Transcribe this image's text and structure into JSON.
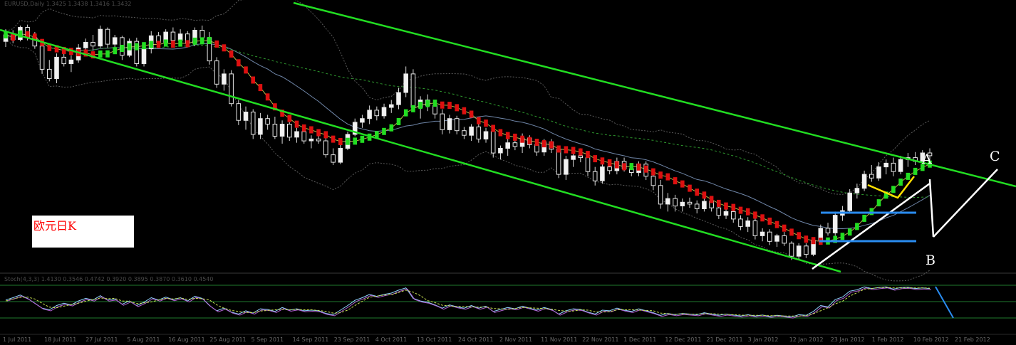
{
  "chart_data": {
    "type": "candlestick",
    "title_box": "欧元日K",
    "main_info": "EURUSD,Daily  1.3425 1.3438 1.3416 1.3432",
    "osc_info": "Stoch(4,3,3) 1.4130 0.3546 0.4742 0.3920 0.3895 0.3870 0.3610 0.4540",
    "wave_labels": [
      "A",
      "B",
      "C"
    ],
    "x_dates": [
      "1 Jul 2011",
      "18 Jul 2011",
      "27 Jul 2011",
      "5 Aug 2011",
      "16 Aug 2011",
      "25 Aug 2011",
      "5 Sep 2011",
      "14 Sep 2011",
      "23 Sep 2011",
      "4 Oct 2011",
      "13 Oct 2011",
      "24 Oct 2011",
      "2 Nov 2011",
      "11 Nov 2011",
      "22 Nov 2011",
      "1 Dec 2011",
      "12 Dec 2011",
      "21 Dec 2011",
      "3 Jan 2012",
      "12 Jan 2012",
      "23 Jan 2012",
      "1 Feb 2012",
      "10 Feb 2012",
      "21 Feb 2012"
    ],
    "candles": [
      {
        "o": 1.445,
        "h": 1.458,
        "l": 1.439,
        "c": 1.452
      },
      {
        "o": 1.452,
        "h": 1.457,
        "l": 1.443,
        "c": 1.447
      },
      {
        "o": 1.447,
        "h": 1.462,
        "l": 1.445,
        "c": 1.46
      },
      {
        "o": 1.46,
        "h": 1.463,
        "l": 1.446,
        "c": 1.449
      },
      {
        "o": 1.449,
        "h": 1.455,
        "l": 1.437,
        "c": 1.44
      },
      {
        "o": 1.44,
        "h": 1.443,
        "l": 1.41,
        "c": 1.415
      },
      {
        "o": 1.415,
        "h": 1.425,
        "l": 1.402,
        "c": 1.405
      },
      {
        "o": 1.405,
        "h": 1.432,
        "l": 1.4,
        "c": 1.428
      },
      {
        "o": 1.428,
        "h": 1.436,
        "l": 1.418,
        "c": 1.421
      },
      {
        "o": 1.421,
        "h": 1.43,
        "l": 1.412,
        "c": 1.425
      },
      {
        "o": 1.425,
        "h": 1.442,
        "l": 1.422,
        "c": 1.438
      },
      {
        "o": 1.438,
        "h": 1.448,
        "l": 1.43,
        "c": 1.444
      },
      {
        "o": 1.444,
        "h": 1.452,
        "l": 1.435,
        "c": 1.44
      },
      {
        "o": 1.44,
        "h": 1.462,
        "l": 1.438,
        "c": 1.458
      },
      {
        "o": 1.458,
        "h": 1.46,
        "l": 1.438,
        "c": 1.442
      },
      {
        "o": 1.442,
        "h": 1.452,
        "l": 1.432,
        "c": 1.449
      },
      {
        "o": 1.449,
        "h": 1.451,
        "l": 1.425,
        "c": 1.43
      },
      {
        "o": 1.43,
        "h": 1.448,
        "l": 1.428,
        "c": 1.445
      },
      {
        "o": 1.445,
        "h": 1.449,
        "l": 1.418,
        "c": 1.421
      },
      {
        "o": 1.421,
        "h": 1.44,
        "l": 1.418,
        "c": 1.437
      },
      {
        "o": 1.437,
        "h": 1.456,
        "l": 1.432,
        "c": 1.451
      },
      {
        "o": 1.451,
        "h": 1.455,
        "l": 1.44,
        "c": 1.444
      },
      {
        "o": 1.444,
        "h": 1.458,
        "l": 1.44,
        "c": 1.455
      },
      {
        "o": 1.455,
        "h": 1.46,
        "l": 1.442,
        "c": 1.446
      },
      {
        "o": 1.446,
        "h": 1.458,
        "l": 1.441,
        "c": 1.453
      },
      {
        "o": 1.453,
        "h": 1.456,
        "l": 1.44,
        "c": 1.443
      },
      {
        "o": 1.443,
        "h": 1.46,
        "l": 1.44,
        "c": 1.457
      },
      {
        "o": 1.457,
        "h": 1.462,
        "l": 1.445,
        "c": 1.449
      },
      {
        "o": 1.449,
        "h": 1.455,
        "l": 1.42,
        "c": 1.424
      },
      {
        "o": 1.424,
        "h": 1.428,
        "l": 1.395,
        "c": 1.399
      },
      {
        "o": 1.399,
        "h": 1.415,
        "l": 1.392,
        "c": 1.41
      },
      {
        "o": 1.41,
        "h": 1.414,
        "l": 1.375,
        "c": 1.378
      },
      {
        "o": 1.378,
        "h": 1.382,
        "l": 1.355,
        "c": 1.36
      },
      {
        "o": 1.36,
        "h": 1.375,
        "l": 1.35,
        "c": 1.369
      },
      {
        "o": 1.369,
        "h": 1.372,
        "l": 1.34,
        "c": 1.345
      },
      {
        "o": 1.345,
        "h": 1.368,
        "l": 1.34,
        "c": 1.362
      },
      {
        "o": 1.362,
        "h": 1.366,
        "l": 1.35,
        "c": 1.356
      },
      {
        "o": 1.356,
        "h": 1.364,
        "l": 1.34,
        "c": 1.343
      },
      {
        "o": 1.343,
        "h": 1.36,
        "l": 1.335,
        "c": 1.356
      },
      {
        "o": 1.356,
        "h": 1.358,
        "l": 1.338,
        "c": 1.342
      },
      {
        "o": 1.342,
        "h": 1.352,
        "l": 1.336,
        "c": 1.348
      },
      {
        "o": 1.348,
        "h": 1.35,
        "l": 1.335,
        "c": 1.338
      },
      {
        "o": 1.338,
        "h": 1.344,
        "l": 1.33,
        "c": 1.34
      },
      {
        "o": 1.34,
        "h": 1.345,
        "l": 1.335,
        "c": 1.338
      },
      {
        "o": 1.338,
        "h": 1.342,
        "l": 1.32,
        "c": 1.323
      },
      {
        "o": 1.323,
        "h": 1.33,
        "l": 1.312,
        "c": 1.315
      },
      {
        "o": 1.315,
        "h": 1.334,
        "l": 1.313,
        "c": 1.33
      },
      {
        "o": 1.33,
        "h": 1.348,
        "l": 1.328,
        "c": 1.345
      },
      {
        "o": 1.345,
        "h": 1.362,
        "l": 1.343,
        "c": 1.358
      },
      {
        "o": 1.358,
        "h": 1.366,
        "l": 1.352,
        "c": 1.362
      },
      {
        "o": 1.362,
        "h": 1.376,
        "l": 1.356,
        "c": 1.371
      },
      {
        "o": 1.371,
        "h": 1.375,
        "l": 1.36,
        "c": 1.365
      },
      {
        "o": 1.365,
        "h": 1.378,
        "l": 1.362,
        "c": 1.374
      },
      {
        "o": 1.374,
        "h": 1.382,
        "l": 1.368,
        "c": 1.377
      },
      {
        "o": 1.377,
        "h": 1.395,
        "l": 1.372,
        "c": 1.39
      },
      {
        "o": 1.39,
        "h": 1.418,
        "l": 1.385,
        "c": 1.41
      },
      {
        "o": 1.41,
        "h": 1.415,
        "l": 1.37,
        "c": 1.374
      },
      {
        "o": 1.374,
        "h": 1.386,
        "l": 1.362,
        "c": 1.382
      },
      {
        "o": 1.382,
        "h": 1.388,
        "l": 1.37,
        "c": 1.376
      },
      {
        "o": 1.376,
        "h": 1.38,
        "l": 1.362,
        "c": 1.367
      },
      {
        "o": 1.367,
        "h": 1.372,
        "l": 1.345,
        "c": 1.35
      },
      {
        "o": 1.35,
        "h": 1.366,
        "l": 1.346,
        "c": 1.362
      },
      {
        "o": 1.362,
        "h": 1.365,
        "l": 1.345,
        "c": 1.349
      },
      {
        "o": 1.349,
        "h": 1.353,
        "l": 1.34,
        "c": 1.344
      },
      {
        "o": 1.344,
        "h": 1.356,
        "l": 1.338,
        "c": 1.353
      },
      {
        "o": 1.353,
        "h": 1.356,
        "l": 1.336,
        "c": 1.34
      },
      {
        "o": 1.34,
        "h": 1.352,
        "l": 1.336,
        "c": 1.348
      },
      {
        "o": 1.348,
        "h": 1.35,
        "l": 1.32,
        "c": 1.325
      },
      {
        "o": 1.325,
        "h": 1.333,
        "l": 1.318,
        "c": 1.33
      },
      {
        "o": 1.33,
        "h": 1.34,
        "l": 1.322,
        "c": 1.336
      },
      {
        "o": 1.336,
        "h": 1.342,
        "l": 1.328,
        "c": 1.332
      },
      {
        "o": 1.332,
        "h": 1.346,
        "l": 1.325,
        "c": 1.341
      },
      {
        "o": 1.341,
        "h": 1.344,
        "l": 1.33,
        "c": 1.334
      },
      {
        "o": 1.334,
        "h": 1.338,
        "l": 1.322,
        "c": 1.326
      },
      {
        "o": 1.326,
        "h": 1.34,
        "l": 1.322,
        "c": 1.337
      },
      {
        "o": 1.337,
        "h": 1.34,
        "l": 1.325,
        "c": 1.329
      },
      {
        "o": 1.329,
        "h": 1.333,
        "l": 1.298,
        "c": 1.302
      },
      {
        "o": 1.302,
        "h": 1.322,
        "l": 1.296,
        "c": 1.318
      },
      {
        "o": 1.318,
        "h": 1.326,
        "l": 1.31,
        "c": 1.322
      },
      {
        "o": 1.322,
        "h": 1.33,
        "l": 1.315,
        "c": 1.32
      },
      {
        "o": 1.32,
        "h": 1.326,
        "l": 1.3,
        "c": 1.305
      },
      {
        "o": 1.305,
        "h": 1.31,
        "l": 1.29,
        "c": 1.295
      },
      {
        "o": 1.295,
        "h": 1.315,
        "l": 1.292,
        "c": 1.31
      },
      {
        "o": 1.31,
        "h": 1.316,
        "l": 1.302,
        "c": 1.306
      },
      {
        "o": 1.306,
        "h": 1.32,
        "l": 1.302,
        "c": 1.316
      },
      {
        "o": 1.316,
        "h": 1.32,
        "l": 1.305,
        "c": 1.308
      },
      {
        "o": 1.308,
        "h": 1.312,
        "l": 1.3,
        "c": 1.304
      },
      {
        "o": 1.304,
        "h": 1.316,
        "l": 1.3,
        "c": 1.313
      },
      {
        "o": 1.313,
        "h": 1.316,
        "l": 1.296,
        "c": 1.3
      },
      {
        "o": 1.3,
        "h": 1.305,
        "l": 1.285,
        "c": 1.29
      },
      {
        "o": 1.29,
        "h": 1.296,
        "l": 1.265,
        "c": 1.27
      },
      {
        "o": 1.27,
        "h": 1.282,
        "l": 1.262,
        "c": 1.276
      },
      {
        "o": 1.276,
        "h": 1.28,
        "l": 1.262,
        "c": 1.268
      },
      {
        "o": 1.268,
        "h": 1.276,
        "l": 1.262,
        "c": 1.272
      },
      {
        "o": 1.272,
        "h": 1.277,
        "l": 1.266,
        "c": 1.27
      },
      {
        "o": 1.27,
        "h": 1.274,
        "l": 1.26,
        "c": 1.265
      },
      {
        "o": 1.265,
        "h": 1.276,
        "l": 1.262,
        "c": 1.273
      },
      {
        "o": 1.273,
        "h": 1.276,
        "l": 1.262,
        "c": 1.266
      },
      {
        "o": 1.266,
        "h": 1.27,
        "l": 1.254,
        "c": 1.258
      },
      {
        "o": 1.258,
        "h": 1.266,
        "l": 1.254,
        "c": 1.262
      },
      {
        "o": 1.262,
        "h": 1.265,
        "l": 1.25,
        "c": 1.254
      },
      {
        "o": 1.254,
        "h": 1.258,
        "l": 1.242,
        "c": 1.246
      },
      {
        "o": 1.246,
        "h": 1.256,
        "l": 1.24,
        "c": 1.252
      },
      {
        "o": 1.252,
        "h": 1.255,
        "l": 1.232,
        "c": 1.236
      },
      {
        "o": 1.236,
        "h": 1.244,
        "l": 1.23,
        "c": 1.24
      },
      {
        "o": 1.24,
        "h": 1.243,
        "l": 1.226,
        "c": 1.23
      },
      {
        "o": 1.23,
        "h": 1.238,
        "l": 1.224,
        "c": 1.236
      },
      {
        "o": 1.236,
        "h": 1.24,
        "l": 1.225,
        "c": 1.228
      },
      {
        "o": 1.228,
        "h": 1.23,
        "l": 1.21,
        "c": 1.214
      },
      {
        "o": 1.214,
        "h": 1.228,
        "l": 1.21,
        "c": 1.225
      },
      {
        "o": 1.225,
        "h": 1.228,
        "l": 1.212,
        "c": 1.216
      },
      {
        "o": 1.216,
        "h": 1.234,
        "l": 1.214,
        "c": 1.231
      },
      {
        "o": 1.231,
        "h": 1.248,
        "l": 1.228,
        "c": 1.244
      },
      {
        "o": 1.244,
        "h": 1.25,
        "l": 1.236,
        "c": 1.239
      },
      {
        "o": 1.239,
        "h": 1.262,
        "l": 1.236,
        "c": 1.258
      },
      {
        "o": 1.258,
        "h": 1.268,
        "l": 1.252,
        "c": 1.263
      },
      {
        "o": 1.263,
        "h": 1.286,
        "l": 1.26,
        "c": 1.282
      },
      {
        "o": 1.282,
        "h": 1.292,
        "l": 1.276,
        "c": 1.287
      },
      {
        "o": 1.287,
        "h": 1.306,
        "l": 1.284,
        "c": 1.302
      },
      {
        "o": 1.302,
        "h": 1.312,
        "l": 1.294,
        "c": 1.298
      },
      {
        "o": 1.298,
        "h": 1.315,
        "l": 1.295,
        "c": 1.31
      },
      {
        "o": 1.31,
        "h": 1.318,
        "l": 1.302,
        "c": 1.314
      },
      {
        "o": 1.314,
        "h": 1.32,
        "l": 1.3,
        "c": 1.305
      },
      {
        "o": 1.305,
        "h": 1.322,
        "l": 1.302,
        "c": 1.318
      },
      {
        "o": 1.318,
        "h": 1.325,
        "l": 1.31,
        "c": 1.32
      },
      {
        "o": 1.32,
        "h": 1.326,
        "l": 1.312,
        "c": 1.316
      },
      {
        "o": 1.316,
        "h": 1.328,
        "l": 1.314,
        "c": 1.325
      },
      {
        "o": 1.325,
        "h": 1.33,
        "l": 1.316,
        "c": 1.322
      }
    ],
    "stochastic": {
      "k": [
        55,
        62,
        70,
        60,
        45,
        30,
        25,
        38,
        45,
        40,
        52,
        60,
        55,
        68,
        55,
        58,
        42,
        52,
        38,
        48,
        62,
        55,
        64,
        56,
        62,
        52,
        66,
        60,
        38,
        22,
        30,
        18,
        12,
        22,
        15,
        28,
        26,
        20,
        32,
        24,
        28,
        22,
        24,
        22,
        14,
        10,
        24,
        38,
        54,
        62,
        72,
        66,
        72,
        76,
        85,
        92,
        60,
        52,
        48,
        40,
        30,
        40,
        34,
        30,
        38,
        30,
        36,
        20,
        26,
        32,
        28,
        36,
        30,
        24,
        32,
        26,
        12,
        22,
        28,
        26,
        18,
        12,
        24,
        22,
        30,
        24,
        20,
        28,
        22,
        16,
        8,
        14,
        10,
        14,
        12,
        10,
        16,
        12,
        8,
        12,
        9,
        6,
        10,
        6,
        9,
        5,
        8,
        6,
        3,
        10,
        8,
        20,
        38,
        34,
        56,
        64,
        82,
        86,
        95,
        90,
        93,
        95,
        88,
        93,
        94,
        90,
        92,
        90
      ],
      "d": [
        52,
        58,
        63,
        64,
        58,
        45,
        33,
        31,
        36,
        41,
        45,
        51,
        56,
        61,
        59,
        60,
        52,
        51,
        44,
        46,
        49,
        55,
        60,
        58,
        61,
        57,
        60,
        59,
        55,
        40,
        30,
        23,
        20,
        17,
        16,
        21,
        23,
        25,
        26,
        25,
        26,
        25,
        25,
        23,
        20,
        15,
        16,
        24,
        38,
        51,
        63,
        67,
        70,
        71,
        78,
        85,
        79,
        68,
        53,
        47,
        39,
        37,
        35,
        35,
        34,
        33,
        34,
        29,
        28,
        26,
        29,
        32,
        31,
        30,
        29,
        27,
        23,
        21,
        21,
        25,
        24,
        19,
        18,
        19,
        25,
        25,
        25,
        24,
        23,
        22,
        15,
        13,
        11,
        13,
        12,
        12,
        13,
        13,
        12,
        11,
        10,
        9,
        8,
        8,
        8,
        7,
        7,
        6,
        6,
        6,
        7,
        13,
        22,
        31,
        43,
        51,
        67,
        77,
        88,
        90,
        93,
        93,
        92,
        92,
        92,
        92,
        92,
        91
      ]
    }
  }
}
